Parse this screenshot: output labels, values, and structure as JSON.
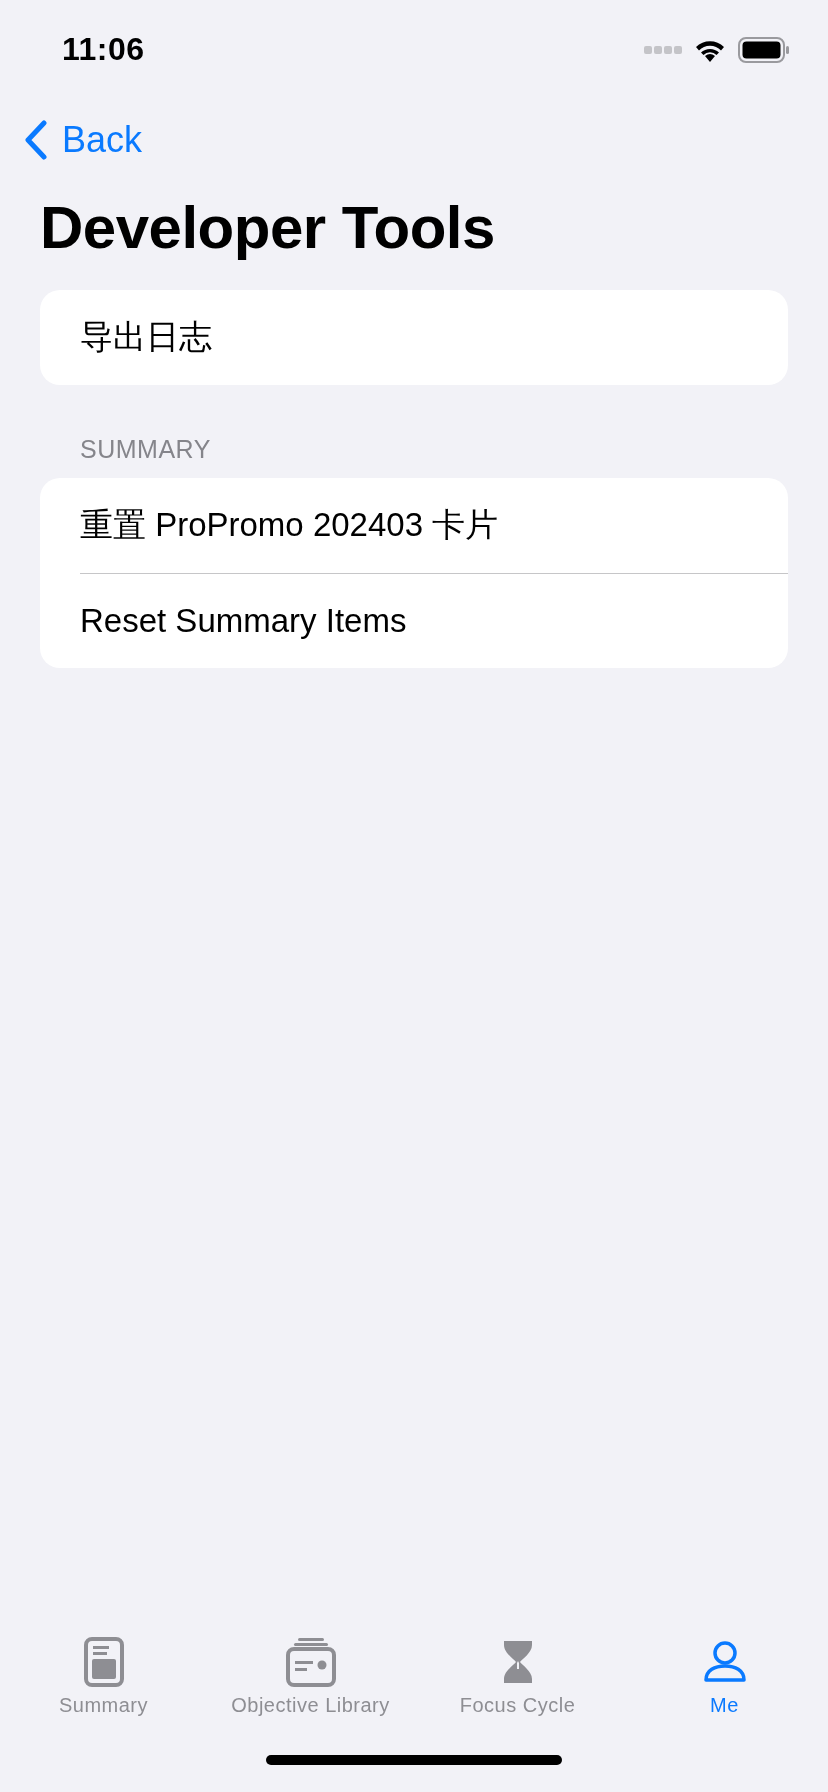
{
  "status_bar": {
    "time": "11:06"
  },
  "navigation": {
    "back": "Back",
    "title": "Developer Tools"
  },
  "sections": [
    {
      "items": [
        "导出日志"
      ]
    },
    {
      "header": "SUMMARY",
      "items": [
        "重置 ProPromo 202403 卡片",
        "Reset Summary Items"
      ]
    }
  ],
  "tab_bar": [
    {
      "label": "Summary",
      "selected": false
    },
    {
      "label": "Objective Library",
      "selected": false
    },
    {
      "label": "Focus Cycle",
      "selected": false
    },
    {
      "label": "Me",
      "selected": true
    }
  ]
}
